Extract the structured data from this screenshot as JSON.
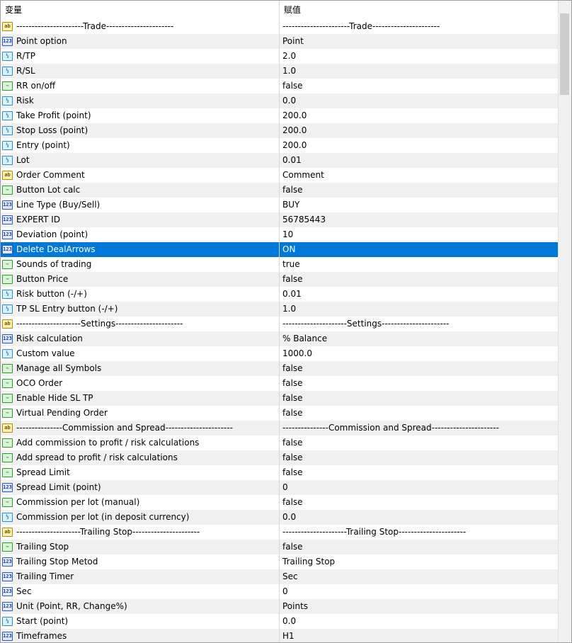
{
  "header": {
    "col_name": "变量",
    "col_value": "赋值"
  },
  "rows": [
    {
      "icon": "ab",
      "icon_name": "string-type-icon",
      "name": "----------------------Trade----------------------",
      "value": "----------------------Trade----------------------"
    },
    {
      "icon": "n123",
      "icon_name": "integer-type-icon",
      "name": "Point option",
      "value": "Point"
    },
    {
      "icon": "half",
      "icon_name": "double-type-icon",
      "name": "R/TP",
      "value": "2.0"
    },
    {
      "icon": "half",
      "icon_name": "double-type-icon",
      "name": "R/SL",
      "value": "1.0"
    },
    {
      "icon": "bool",
      "icon_name": "bool-type-icon",
      "name": "RR on/off",
      "value": "false"
    },
    {
      "icon": "half",
      "icon_name": "double-type-icon",
      "name": "Risk",
      "value": "0.0"
    },
    {
      "icon": "half",
      "icon_name": "double-type-icon",
      "name": "Take Profit (point)",
      "value": "200.0"
    },
    {
      "icon": "half",
      "icon_name": "double-type-icon",
      "name": "Stop Loss (point)",
      "value": "200.0"
    },
    {
      "icon": "half",
      "icon_name": "double-type-icon",
      "name": "Entry (point)",
      "value": "200.0"
    },
    {
      "icon": "half",
      "icon_name": "double-type-icon",
      "name": "Lot",
      "value": "0.01"
    },
    {
      "icon": "ab",
      "icon_name": "string-type-icon",
      "name": "Order Comment",
      "value": "Comment"
    },
    {
      "icon": "bool",
      "icon_name": "bool-type-icon",
      "name": "Button Lot calc",
      "value": "false"
    },
    {
      "icon": "n123",
      "icon_name": "integer-type-icon",
      "name": "Line Type (Buy/Sell)",
      "value": "BUY"
    },
    {
      "icon": "n123",
      "icon_name": "integer-type-icon",
      "name": "EXPERT ID",
      "value": "56785443"
    },
    {
      "icon": "n123",
      "icon_name": "integer-type-icon",
      "name": "Deviation (point)",
      "value": "10"
    },
    {
      "icon": "n123",
      "icon_name": "integer-type-icon",
      "name": "Delete DealArrows",
      "value": "ON",
      "selected": true
    },
    {
      "icon": "bool",
      "icon_name": "bool-type-icon",
      "name": "Sounds of trading",
      "value": "true"
    },
    {
      "icon": "bool",
      "icon_name": "bool-type-icon",
      "name": "Button Price",
      "value": "false"
    },
    {
      "icon": "half",
      "icon_name": "double-type-icon",
      "name": "Risk button (-/+)",
      "value": "0.01"
    },
    {
      "icon": "half",
      "icon_name": "double-type-icon",
      "name": "TP SL Entry button (-/+)",
      "value": "1.0"
    },
    {
      "icon": "ab",
      "icon_name": "string-type-icon",
      "name": "---------------------Settings----------------------",
      "value": "---------------------Settings----------------------"
    },
    {
      "icon": "n123",
      "icon_name": "integer-type-icon",
      "name": "Risk calculation",
      "value": "% Balance"
    },
    {
      "icon": "half",
      "icon_name": "double-type-icon",
      "name": "Custom value",
      "value": "1000.0"
    },
    {
      "icon": "bool",
      "icon_name": "bool-type-icon",
      "name": "Manage all Symbols",
      "value": "false"
    },
    {
      "icon": "bool",
      "icon_name": "bool-type-icon",
      "name": "OCO Order",
      "value": "false"
    },
    {
      "icon": "bool",
      "icon_name": "bool-type-icon",
      "name": "Enable Hide SL TP",
      "value": "false"
    },
    {
      "icon": "bool",
      "icon_name": "bool-type-icon",
      "name": "Virtual Pending Order",
      "value": "false"
    },
    {
      "icon": "ab",
      "icon_name": "string-type-icon",
      "name": "---------------Commission and Spread----------------------",
      "value": "---------------Commission and Spread----------------------"
    },
    {
      "icon": "bool",
      "icon_name": "bool-type-icon",
      "name": "Add commission to profit / risk calculations",
      "value": "false"
    },
    {
      "icon": "bool",
      "icon_name": "bool-type-icon",
      "name": "Add spread to profit / risk calculations",
      "value": "false"
    },
    {
      "icon": "bool",
      "icon_name": "bool-type-icon",
      "name": "Spread Limit",
      "value": "false"
    },
    {
      "icon": "n123",
      "icon_name": "integer-type-icon",
      "name": "Spread Limit (point)",
      "value": "0"
    },
    {
      "icon": "bool",
      "icon_name": "bool-type-icon",
      "name": "Commission per lot (manual)",
      "value": "false"
    },
    {
      "icon": "half",
      "icon_name": "double-type-icon",
      "name": "Commission per lot (in deposit currency)",
      "value": "0.0"
    },
    {
      "icon": "ab",
      "icon_name": "string-type-icon",
      "name": "---------------------Trailing Stop----------------------",
      "value": "---------------------Trailing Stop----------------------"
    },
    {
      "icon": "bool",
      "icon_name": "bool-type-icon",
      "name": "Trailing Stop",
      "value": "false"
    },
    {
      "icon": "n123",
      "icon_name": "integer-type-icon",
      "name": "Trailing Stop Metod",
      "value": "Trailing Stop"
    },
    {
      "icon": "n123",
      "icon_name": "integer-type-icon",
      "name": "Trailing Timer",
      "value": "Sec"
    },
    {
      "icon": "n123",
      "icon_name": "integer-type-icon",
      "name": "Sec",
      "value": "0"
    },
    {
      "icon": "n123",
      "icon_name": "integer-type-icon",
      "name": "Unit (Point, RR, Change%)",
      "value": "Points"
    },
    {
      "icon": "half",
      "icon_name": "double-type-icon",
      "name": "Start (point)",
      "value": "0.0"
    },
    {
      "icon": "n123",
      "icon_name": "integer-type-icon",
      "name": "Timeframes",
      "value": "H1"
    }
  ],
  "icon_glyphs": {
    "ab": "ab",
    "n123": "123",
    "half": "½",
    "bool": "~"
  },
  "colors": {
    "selection": "#0078d7",
    "row_alt": "#f0f0f0"
  }
}
